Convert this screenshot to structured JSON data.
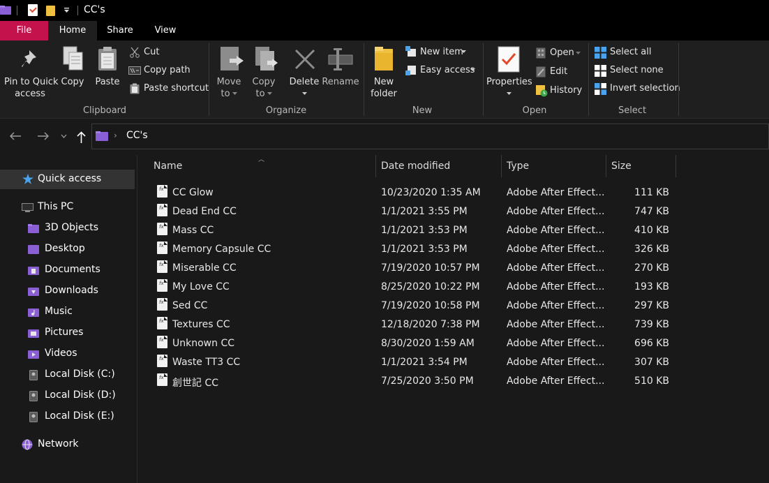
{
  "window": {
    "title": "CC's"
  },
  "tabs": {
    "file": "File",
    "home": "Home",
    "share": "Share",
    "view": "View"
  },
  "ribbon": {
    "clipboard": {
      "pin_line1": "Pin to Quick",
      "pin_line2": "access",
      "copy": "Copy",
      "paste": "Paste",
      "cut": "Cut",
      "copy_path": "Copy path",
      "paste_shortcut": "Paste shortcut",
      "group_label": "Clipboard"
    },
    "organize": {
      "move_line1": "Move",
      "move_line2": "to",
      "copy_line1": "Copy",
      "copy_line2": "to",
      "delete": "Delete",
      "rename": "Rename",
      "group_label": "Organize"
    },
    "new": {
      "new_folder_line1": "New",
      "new_folder_line2": "folder",
      "new_item": "New item",
      "easy_access": "Easy access",
      "group_label": "New"
    },
    "open": {
      "properties": "Properties",
      "open": "Open",
      "edit": "Edit",
      "history": "History",
      "group_label": "Open"
    },
    "select": {
      "select_all": "Select all",
      "select_none": "Select none",
      "invert_selection": "Invert selection",
      "group_label": "Select"
    }
  },
  "address": {
    "path": "CC's"
  },
  "sidebar": {
    "quick_access": "Quick access",
    "this_pc": "This PC",
    "items": [
      {
        "label": "3D Objects"
      },
      {
        "label": "Desktop"
      },
      {
        "label": "Documents"
      },
      {
        "label": "Downloads"
      },
      {
        "label": "Music"
      },
      {
        "label": "Pictures"
      },
      {
        "label": "Videos"
      },
      {
        "label": "Local Disk (C:)"
      },
      {
        "label": "Local Disk (D:)"
      },
      {
        "label": "Local Disk (E:)"
      }
    ],
    "network": "Network"
  },
  "columns": {
    "name": "Name",
    "date": "Date modified",
    "type": "Type",
    "size": "Size"
  },
  "files": [
    {
      "name": "CC Glow",
      "date": "10/23/2020 1:35 AM",
      "type": "Adobe After Effect...",
      "size": "111 KB"
    },
    {
      "name": "Dead End CC",
      "date": "1/1/2021 3:55 PM",
      "type": "Adobe After Effect...",
      "size": "747 KB"
    },
    {
      "name": "Mass CC",
      "date": "1/1/2021 3:53 PM",
      "type": "Adobe After Effect...",
      "size": "410 KB"
    },
    {
      "name": "Memory Capsule CC",
      "date": "1/1/2021 3:53 PM",
      "type": "Adobe After Effect...",
      "size": "326 KB"
    },
    {
      "name": "Miserable CC",
      "date": "7/19/2020 10:57 PM",
      "type": "Adobe After Effect...",
      "size": "270 KB"
    },
    {
      "name": "My Love CC",
      "date": "8/25/2020 10:22 PM",
      "type": "Adobe After Effect...",
      "size": "193 KB"
    },
    {
      "name": "Sed CC",
      "date": "7/19/2020 10:58 PM",
      "type": "Adobe After Effect...",
      "size": "297 KB"
    },
    {
      "name": "Textures CC",
      "date": "12/18/2020 7:38 PM",
      "type": "Adobe After Effect...",
      "size": "739 KB"
    },
    {
      "name": "Unknown CC",
      "date": "8/30/2020 1:59 AM",
      "type": "Adobe After Effect...",
      "size": "696 KB"
    },
    {
      "name": "Waste TT3 CC",
      "date": "1/1/2021 3:54 PM",
      "type": "Adobe After Effect...",
      "size": "307 KB"
    },
    {
      "name": "創世記 CC",
      "date": "7/25/2020 3:50 PM",
      "type": "Adobe After Effect...",
      "size": "510 KB"
    }
  ],
  "colors": {
    "file_tab": "#c4124d",
    "folder_purple": "#8a5fd6",
    "folder_yellow": "#f0c040",
    "accent_blue": "#4aa3ef"
  }
}
